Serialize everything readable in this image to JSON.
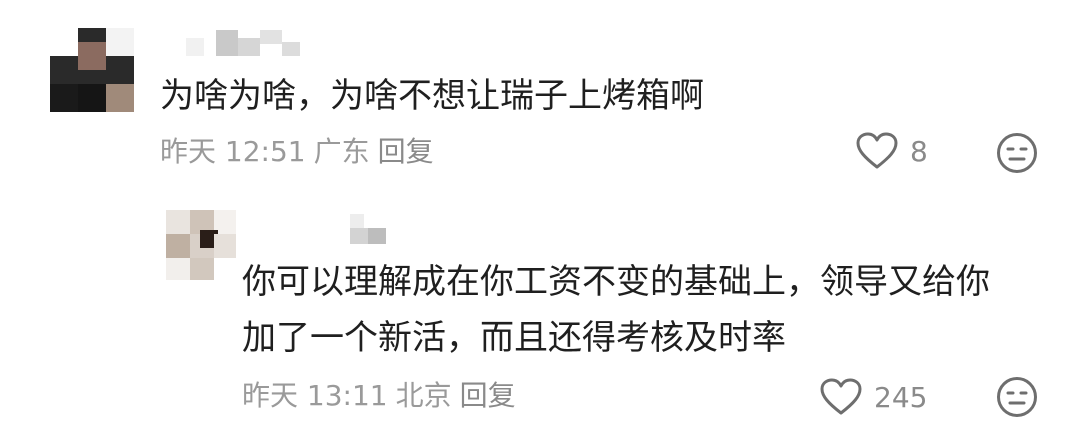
{
  "comments": [
    {
      "text": "为啥为啥，为啥不想让瑞子上烤箱啊",
      "time": "昨天 12:51",
      "location": "广东",
      "reply_label": "回复",
      "like_count": "8"
    },
    {
      "text_line1": "你可以理解成在你工资不变的基础上，领导又给你",
      "text_line2": "加了一个新活，而且还得考核及时率",
      "time": "昨天 13:11",
      "location": "北京",
      "reply_label": "回复",
      "like_count": "245"
    }
  ],
  "icons": {
    "like": "heart-outline-icon",
    "dislike": "neutral-face-icon"
  },
  "colors": {
    "text": "#1f1f1f",
    "meta": "#9a9a9a",
    "icon": "#6e6e6e"
  }
}
